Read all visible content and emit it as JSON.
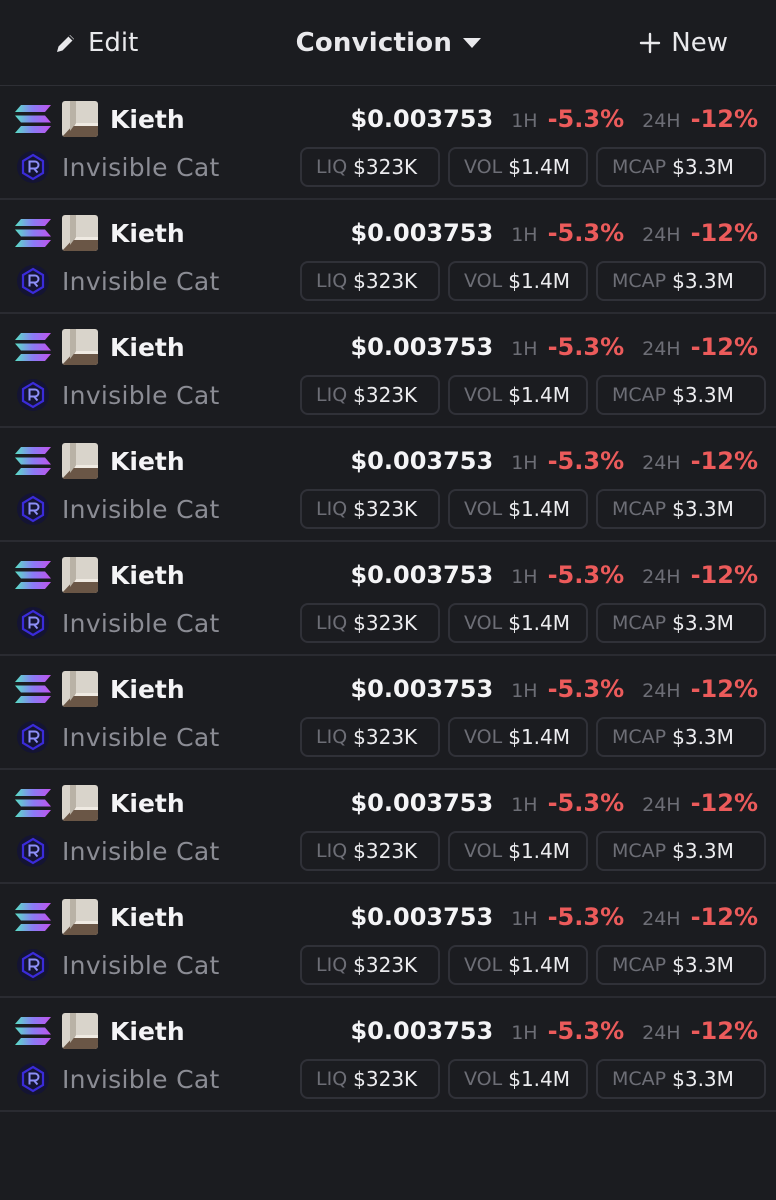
{
  "header": {
    "edit_label": "Edit",
    "title": "Conviction",
    "new_label": "New"
  },
  "colors": {
    "background": "#1b1c20",
    "negative": "#ec5b5b",
    "muted": "#6d6e76",
    "accent_dex": "#3a2bd9"
  },
  "row": {
    "chain_icon": "solana-icon",
    "dex_icon": "raydium-icon",
    "name": "Kieth",
    "subtitle": "Invisible Cat",
    "price": "$0.003753",
    "h1_label": "1H",
    "h1_change": "-5.3%",
    "h24_label": "24H",
    "h24_change": "-12%",
    "liq_label": "LIQ",
    "liq_value": "$323K",
    "vol_label": "VOL",
    "vol_value": "$1.4M",
    "mcap_label": "MCAP",
    "mcap_value": "$3.3M"
  },
  "row_count": 9
}
